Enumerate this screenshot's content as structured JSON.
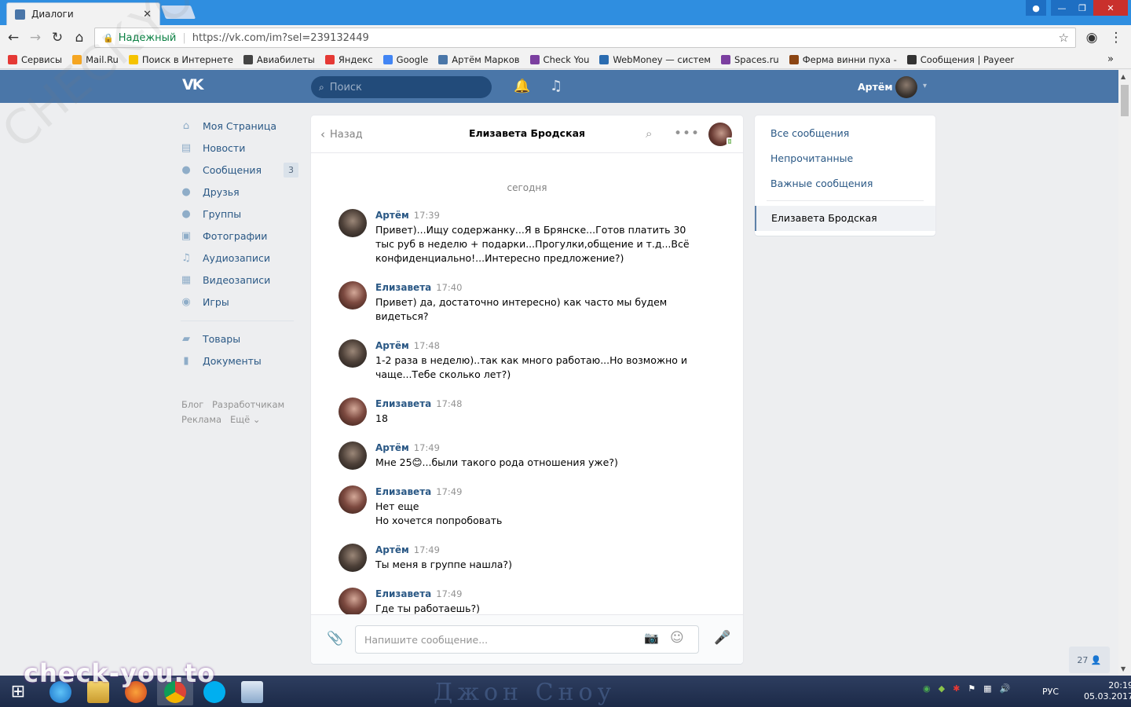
{
  "browser": {
    "tab_title": "Диалоги",
    "tab_close": "✕",
    "secure_label": "Надежный",
    "url": "https://vk.com/im?sel=239132449",
    "bookmarks": [
      {
        "label": "Сервисы",
        "color": "#e53935"
      },
      {
        "label": "Mail.Ru",
        "color": "#f5a623"
      },
      {
        "label": "Поиск в Интернете",
        "color": "#f5c300"
      },
      {
        "label": "Авиабилеты",
        "color": "#444444"
      },
      {
        "label": "Яндекс",
        "color": "#e53935"
      },
      {
        "label": "Google",
        "color": "#4285f4"
      },
      {
        "label": "Артём Марков",
        "color": "#4a76a8"
      },
      {
        "label": "Check You",
        "color": "#7b3fa0"
      },
      {
        "label": "WebMoney — систем",
        "color": "#2b6cb0"
      },
      {
        "label": "Spaces.ru",
        "color": "#7b3fa0"
      },
      {
        "label": "Ферма винни пуха - ",
        "color": "#8b4513"
      },
      {
        "label": "Сообщения | Payeer",
        "color": "#333333"
      }
    ],
    "bookmarks_more": "»"
  },
  "vk_header": {
    "logo": "VK",
    "search_placeholder": "Поиск",
    "user_name": "Артём"
  },
  "left_nav": {
    "items": [
      {
        "label": "Моя Страница",
        "icon": "home-icon",
        "glyph": "⌂"
      },
      {
        "label": "Новости",
        "icon": "news-icon",
        "glyph": "▤"
      },
      {
        "label": "Сообщения",
        "icon": "messages-icon",
        "glyph": "●",
        "count": "3"
      },
      {
        "label": "Друзья",
        "icon": "friends-icon",
        "glyph": "●"
      },
      {
        "label": "Группы",
        "icon": "groups-icon",
        "glyph": "●"
      },
      {
        "label": "Фотографии",
        "icon": "photos-icon",
        "glyph": "▣"
      },
      {
        "label": "Аудиозаписи",
        "icon": "audio-icon",
        "glyph": "♫"
      },
      {
        "label": "Видеозаписи",
        "icon": "video-icon",
        "glyph": "▦"
      },
      {
        "label": "Игры",
        "icon": "games-icon",
        "glyph": "◉"
      }
    ],
    "items2": [
      {
        "label": "Товары",
        "icon": "market-icon",
        "glyph": "▰"
      },
      {
        "label": "Документы",
        "icon": "documents-icon",
        "glyph": "▮"
      }
    ],
    "footer": {
      "blog": "Блог",
      "dev": "Разработчикам",
      "ads": "Реклама",
      "more": "Ещё ⌄"
    }
  },
  "dialog": {
    "back_label": "Назад",
    "title": "Елизавета Бродская",
    "date_divider": "сегодня",
    "messages": [
      {
        "author": "Артём",
        "time": "17:39",
        "text": "Привет)...Ищу содержанку...Я в Брянске...Готов платить 30 тыс руб в неделю + подарки...Прогулки,общение и т.д...Всё конфиденциально!...Интересно предложение?)",
        "who": "a"
      },
      {
        "author": "Елизавета",
        "time": "17:40",
        "text": "Привет) да, достаточно интересно) как часто мы будем видеться?",
        "who": "e"
      },
      {
        "author": "Артём",
        "time": "17:48",
        "text": "1-2 раза в неделю)..так как много работаю...Но возможно и чаще...Тебе сколько лет?)",
        "who": "a"
      },
      {
        "author": "Елизавета",
        "time": "17:48",
        "text": "18",
        "who": "e"
      },
      {
        "author": "Артём",
        "time": "17:49",
        "text": "Мне 25😊...были такого рода отношения уже?)",
        "who": "a"
      },
      {
        "author": "Елизавета",
        "time": "17:49",
        "text": "Нет еще\nНо хочется попробовать",
        "who": "e"
      },
      {
        "author": "Артём",
        "time": "17:49",
        "text": "Ты меня в группе нашла?)",
        "who": "a"
      },
      {
        "author": "Елизавета",
        "time": "17:49",
        "text": "Где ты работаешь?)",
        "who": "e"
      }
    ],
    "composer_placeholder": "Напишите сообщение..."
  },
  "right_menu": {
    "all": "Все сообщения",
    "unread": "Непрочитанные",
    "important": "Важные сообщения",
    "active_chat": "Елизавета Бродская"
  },
  "online_count": "27",
  "taskbar": {
    "lang": "РУС",
    "time": "20:19",
    "date": "05.03.2017"
  },
  "watermark": "check-you.to",
  "watermark_diag": "CHECK-YOU.ME",
  "desktop_text": "Джон Сноу"
}
